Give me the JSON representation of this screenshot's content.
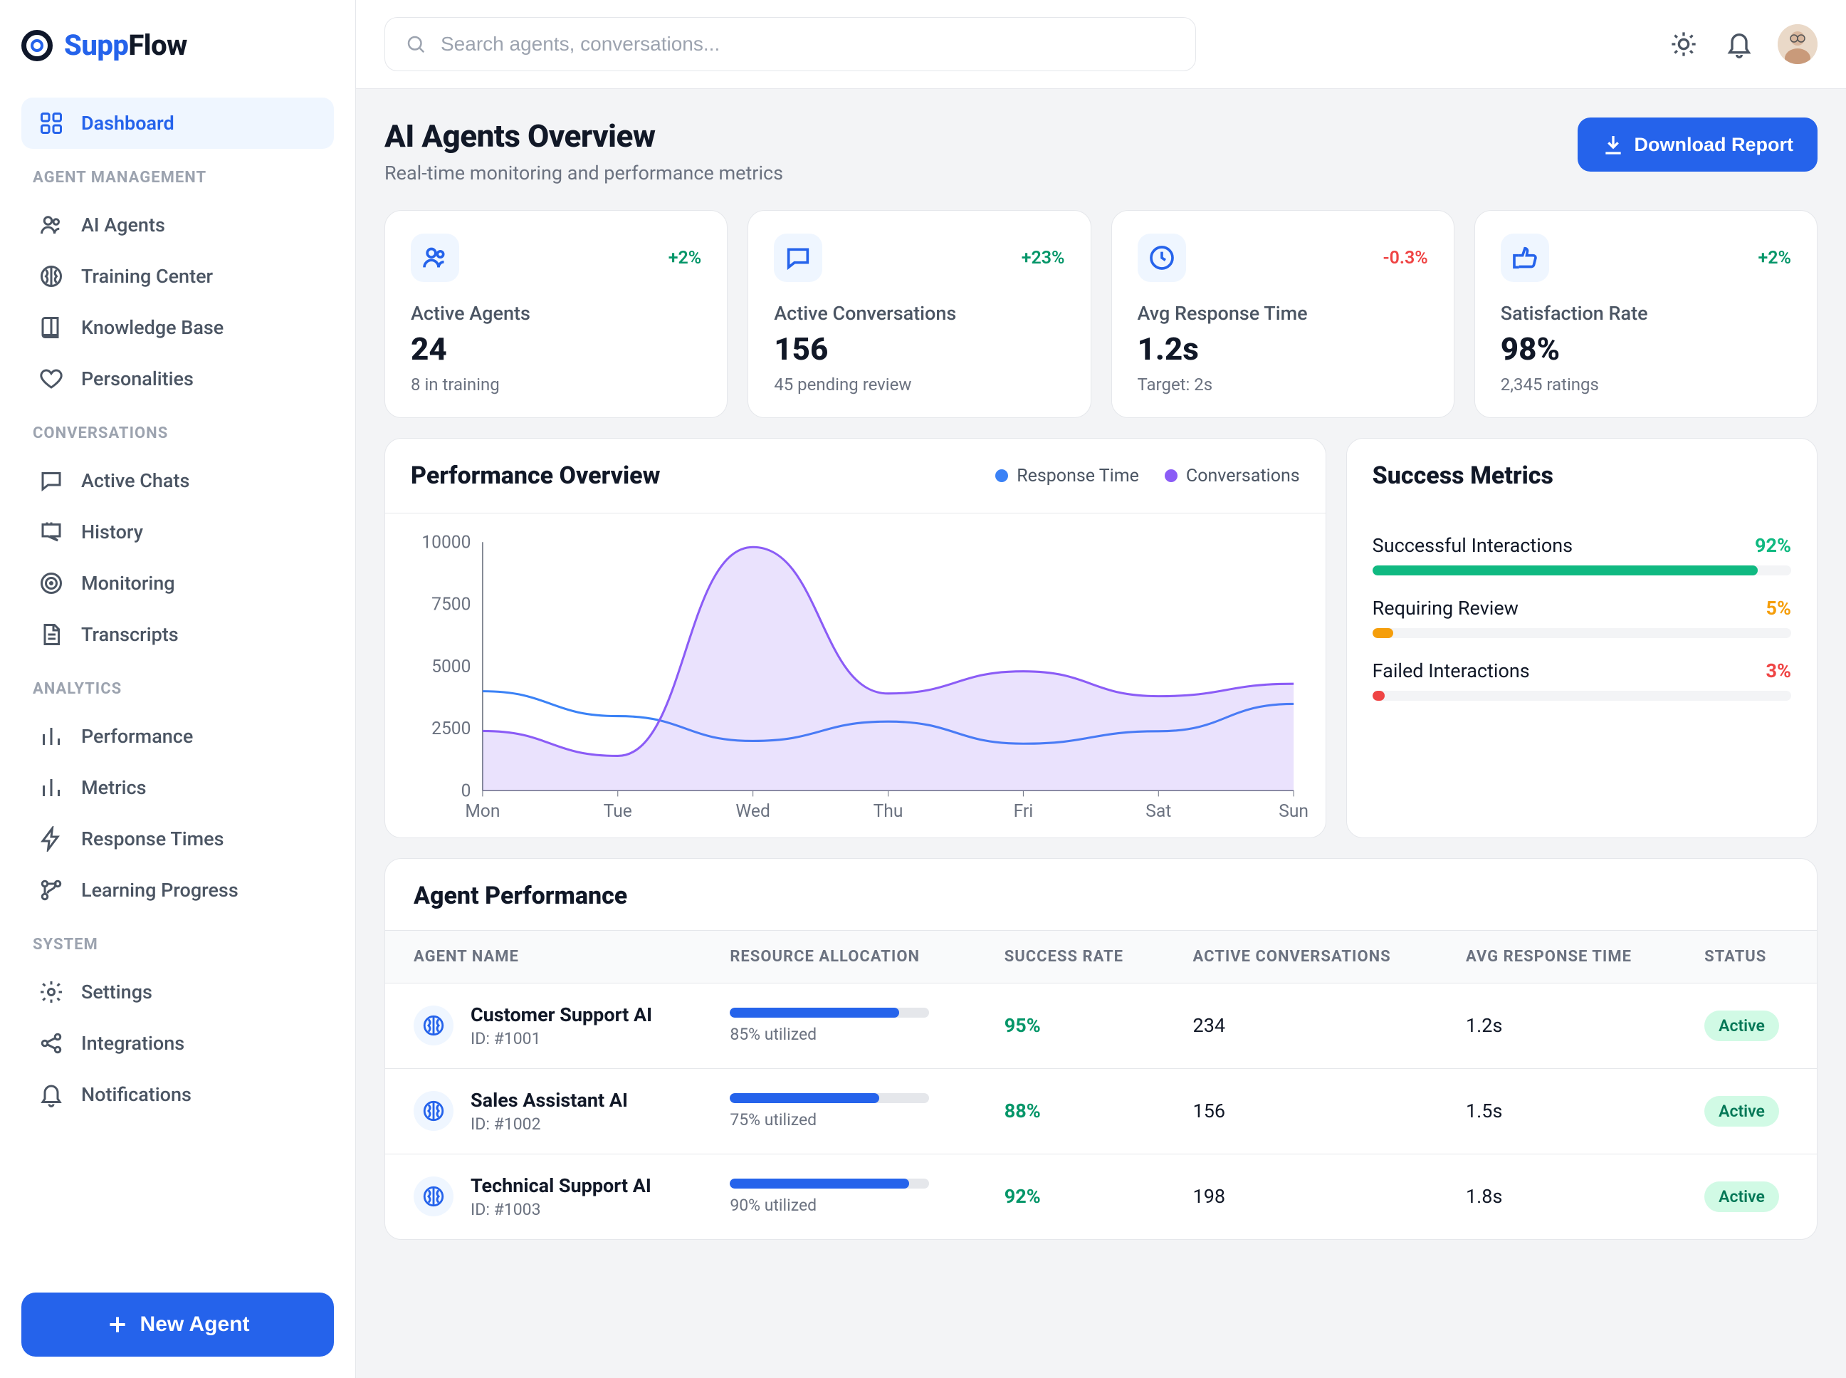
{
  "brand": {
    "name_blue": "Supp",
    "name_rest": "Flow"
  },
  "search": {
    "placeholder": "Search agents, conversations..."
  },
  "sidebar": {
    "items": [
      {
        "label": "Dashboard",
        "name": "dashboard",
        "icon": "dashboard",
        "active": true
      },
      {
        "section": "AGENT MANAGEMENT"
      },
      {
        "label": "AI Agents",
        "name": "ai-agents",
        "icon": "users"
      },
      {
        "label": "Training Center",
        "name": "training-center",
        "icon": "brain"
      },
      {
        "label": "Knowledge Base",
        "name": "knowledge-base",
        "icon": "book"
      },
      {
        "label": "Personalities",
        "name": "personalities",
        "icon": "heart"
      },
      {
        "section": "CONVERSATIONS"
      },
      {
        "label": "Active Chats",
        "name": "active-chats",
        "icon": "chat"
      },
      {
        "label": "History",
        "name": "history",
        "icon": "history"
      },
      {
        "label": "Monitoring",
        "name": "monitoring",
        "icon": "target"
      },
      {
        "label": "Transcripts",
        "name": "transcripts",
        "icon": "file"
      },
      {
        "section": "ANALYTICS"
      },
      {
        "label": "Performance",
        "name": "performance",
        "icon": "bars"
      },
      {
        "label": "Metrics",
        "name": "metrics",
        "icon": "bars"
      },
      {
        "label": "Response Times",
        "name": "response-times",
        "icon": "bolt"
      },
      {
        "label": "Learning Progress",
        "name": "learning-progress",
        "icon": "branch"
      },
      {
        "section": "SYSTEM"
      },
      {
        "label": "Settings",
        "name": "settings",
        "icon": "gear"
      },
      {
        "label": "Integrations",
        "name": "integrations",
        "icon": "share"
      },
      {
        "label": "Notifications",
        "name": "notifications",
        "icon": "bell"
      }
    ],
    "cta_label": "New Agent"
  },
  "header": {
    "title": "AI Agents Overview",
    "subtitle": "Real-time monitoring and performance metrics",
    "download_label": "Download Report"
  },
  "stats": [
    {
      "icon": "users",
      "label": "Active Agents",
      "value": "24",
      "sub": "8 in training",
      "delta": "+2%",
      "delta_positive": true
    },
    {
      "icon": "chat",
      "label": "Active Conversations",
      "value": "156",
      "sub": "45 pending review",
      "delta": "+23%",
      "delta_positive": true
    },
    {
      "icon": "clock",
      "label": "Avg Response Time",
      "value": "1.2s",
      "sub": "Target: 2s",
      "delta": "-0.3%",
      "delta_positive": false
    },
    {
      "icon": "thumb",
      "label": "Satisfaction Rate",
      "value": "98%",
      "sub": "2,345 ratings",
      "delta": "+2%",
      "delta_positive": true
    }
  ],
  "chart_data": {
    "type": "line",
    "title": "Performance Overview",
    "legend": [
      "Response Time",
      "Conversations"
    ],
    "ylim": [
      0,
      10000
    ],
    "yticks": [
      0,
      2500,
      5000,
      7500,
      10000
    ],
    "categories": [
      "Mon",
      "Tue",
      "Wed",
      "Thu",
      "Fri",
      "Sat",
      "Sun"
    ],
    "series": [
      {
        "name": "Response Time",
        "color": "#3B82F6",
        "values": [
          4000,
          3000,
          2000,
          2780,
          1890,
          2390,
          3490
        ]
      },
      {
        "name": "Conversations",
        "color": "#8B5CF6",
        "values": [
          2400,
          1398,
          9800,
          3908,
          4800,
          3800,
          4300
        ],
        "fill": true
      }
    ]
  },
  "success_metrics": {
    "title": "Success Metrics",
    "items": [
      {
        "label": "Successful Interactions",
        "pct": "92%",
        "width": 92,
        "color": "#10B981"
      },
      {
        "label": "Requiring Review",
        "pct": "5%",
        "width": 5,
        "color": "#F59E0B"
      },
      {
        "label": "Failed Interactions",
        "pct": "3%",
        "width": 3,
        "color": "#EF4444"
      }
    ]
  },
  "agent_table": {
    "title": "Agent Performance",
    "columns": [
      "AGENT NAME",
      "RESOURCE ALLOCATION",
      "SUCCESS RATE",
      "ACTIVE CONVERSATIONS",
      "AVG RESPONSE TIME",
      "STATUS"
    ],
    "rows": [
      {
        "name": "Customer Support AI",
        "id": "ID: #1001",
        "util": 85,
        "util_text": "85% utilized",
        "success": "95%",
        "conv": "234",
        "resp": "1.2s",
        "status": "Active"
      },
      {
        "name": "Sales Assistant AI",
        "id": "ID: #1002",
        "util": 75,
        "util_text": "75% utilized",
        "success": "88%",
        "conv": "156",
        "resp": "1.5s",
        "status": "Active"
      },
      {
        "name": "Technical Support AI",
        "id": "ID: #1003",
        "util": 90,
        "util_text": "90% utilized",
        "success": "92%",
        "conv": "198",
        "resp": "1.8s",
        "status": "Active"
      }
    ]
  }
}
